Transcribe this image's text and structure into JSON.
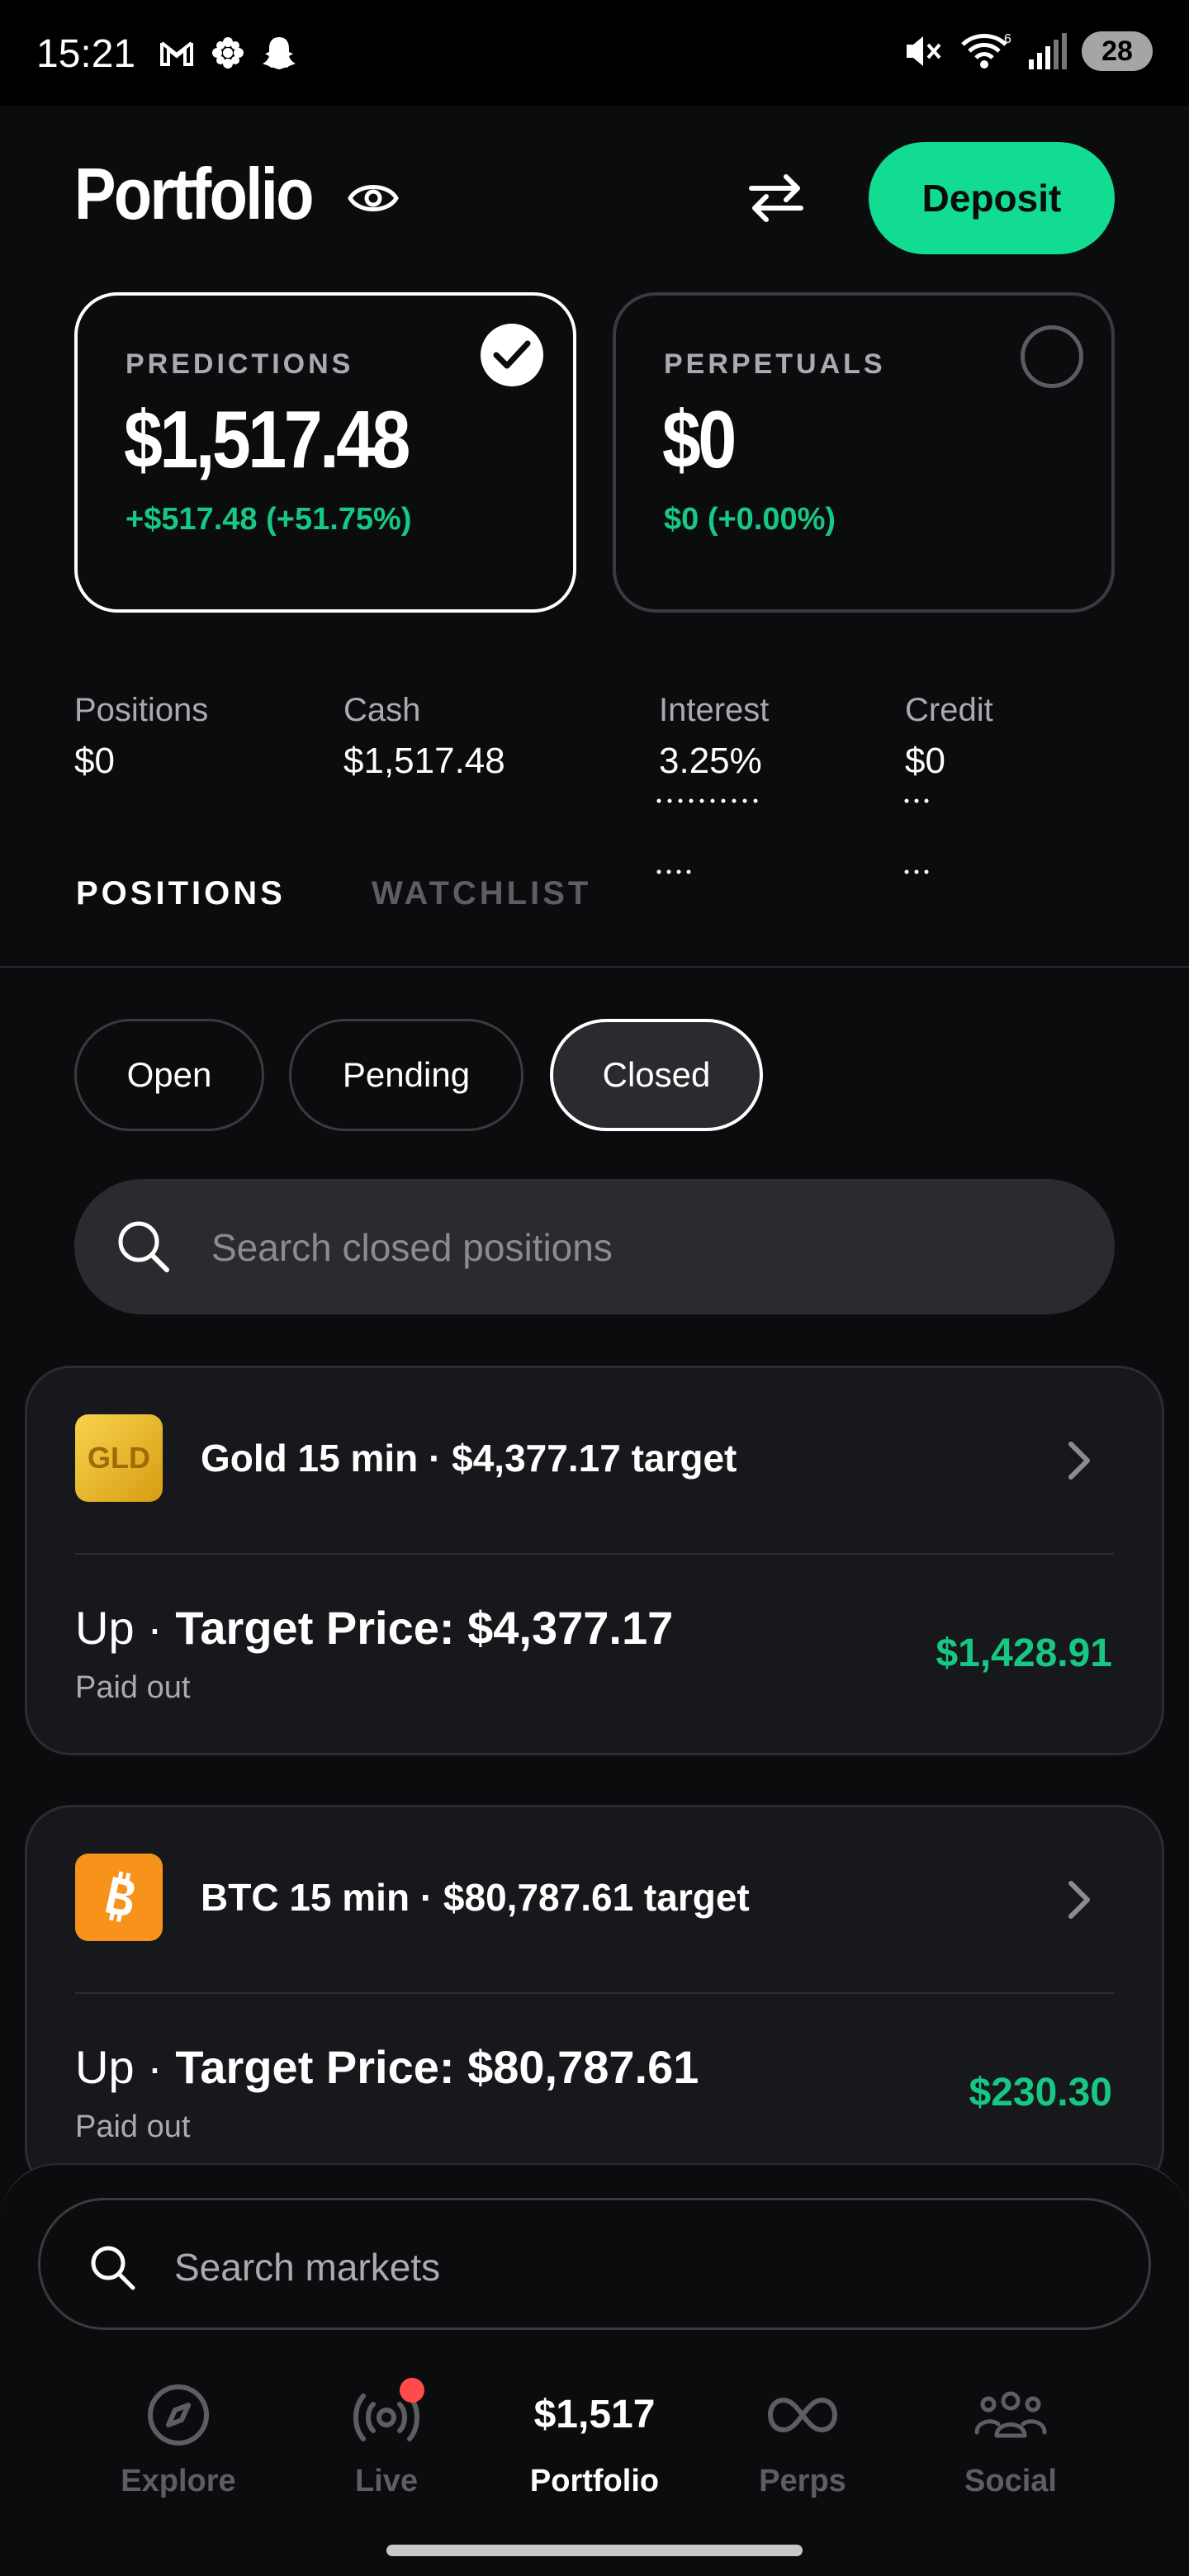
{
  "status": {
    "time": "15:21",
    "battery": "28",
    "signal_badge": "6"
  },
  "header": {
    "title": "Portfolio",
    "deposit_label": "Deposit"
  },
  "accounts": [
    {
      "label": "PREDICTIONS",
      "value": "$1,517.48",
      "change": "+$517.48 (+51.75%)",
      "selected": true
    },
    {
      "label": "PERPETUALS",
      "value": "$0",
      "change": "$0 (+0.00%)",
      "selected": false
    }
  ],
  "stats": [
    {
      "label": "Positions",
      "value": "$0"
    },
    {
      "label": "Cash",
      "value": "$1,517.48"
    },
    {
      "label": "Interest",
      "value": "3.25%"
    },
    {
      "label": "Credit",
      "value": "$0"
    }
  ],
  "tabs": [
    {
      "label": "POSITIONS",
      "active": true
    },
    {
      "label": "WATCHLIST",
      "active": false
    }
  ],
  "filters": [
    {
      "label": "Open",
      "active": false
    },
    {
      "label": "Pending",
      "active": false
    },
    {
      "label": "Closed",
      "active": true
    }
  ],
  "search": {
    "placeholder": "Search closed positions"
  },
  "positions": [
    {
      "icon_text": "GLD",
      "icon": "gold-icon",
      "title": "Gold 15 min · $4,377.17 target",
      "direction": "Up · ",
      "target": "Target Price: $4,377.17",
      "status": "Paid out",
      "amount": "$1,428.91"
    },
    {
      "icon": "bitcoin-icon",
      "title": "BTC 15 min · $80,787.61 target",
      "direction": "Up · ",
      "target": "Target Price: $80,787.61",
      "status": "Paid out",
      "amount": "$230.30"
    }
  ],
  "market_search": {
    "placeholder": "Search markets"
  },
  "nav": [
    {
      "label": "Explore",
      "icon": "compass-icon",
      "active": false
    },
    {
      "label": "Live",
      "icon": "broadcast-icon",
      "active": false
    },
    {
      "label": "Portfolio",
      "amount": "$1,517",
      "active": true
    },
    {
      "label": "Perps",
      "icon": "infinity-icon",
      "active": false
    },
    {
      "label": "Social",
      "icon": "people-icon",
      "active": false
    }
  ],
  "colors": {
    "accent": "#12dc91",
    "positive": "#17c784",
    "background": "#0b0c0e",
    "notification": "#ff4b4b"
  }
}
